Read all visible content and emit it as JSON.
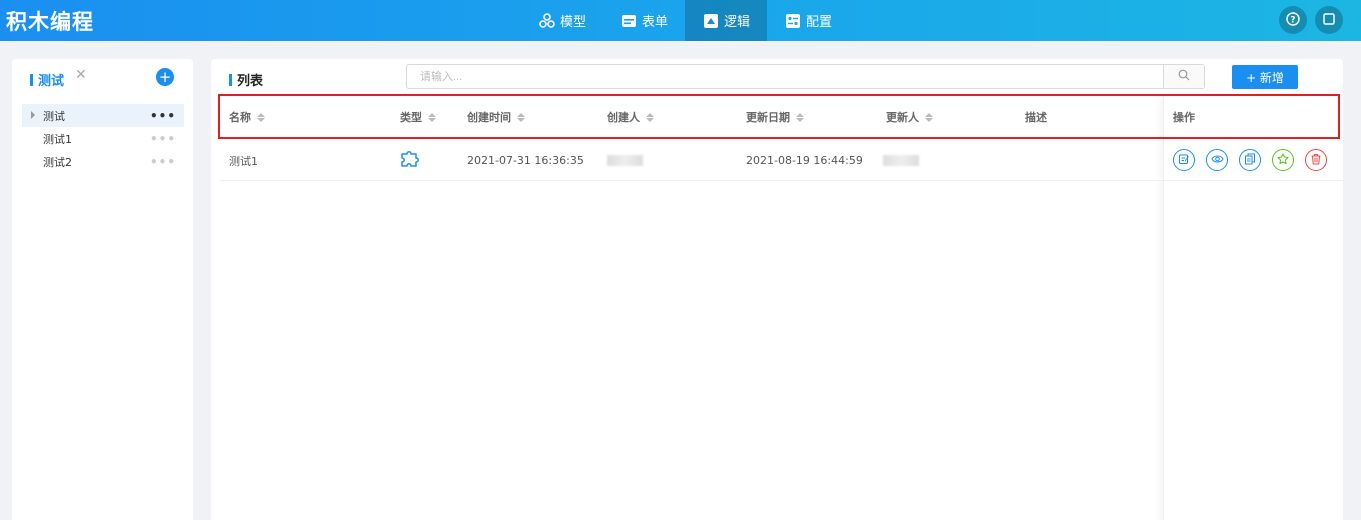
{
  "app": {
    "title": "积木编程"
  },
  "nav": [
    {
      "label": "模型",
      "icon": "model-icon"
    },
    {
      "label": "表单",
      "icon": "form-icon"
    },
    {
      "label": "逻辑",
      "icon": "logic-icon",
      "active": true
    },
    {
      "label": "配置",
      "icon": "config-icon"
    }
  ],
  "header_buttons": {
    "help": "help-icon",
    "window": "window-icon"
  },
  "sidebar": {
    "title": "测试",
    "close": "✕",
    "add": "+",
    "items": [
      {
        "label": "测试",
        "more": "•••",
        "selected": true
      },
      {
        "label": "测试1",
        "more": "•••"
      },
      {
        "label": "测试2",
        "more": "•••"
      }
    ]
  },
  "main": {
    "title": "列表",
    "search": {
      "placeholder": "请输入...",
      "value": ""
    },
    "add_label": "+ 新增",
    "columns": {
      "name": "名称",
      "type": "类型",
      "created_at": "创建时间",
      "creator": "创建人",
      "updated_at": "更新日期",
      "updater": "更新人",
      "desc": "描述",
      "ops": "操作"
    },
    "rows": [
      {
        "name": "测试1",
        "type_icon": "puzzle-icon",
        "created_at": "2021-07-31 16:36:35",
        "updated_at": "2021-08-19 16:44:59",
        "desc": ""
      }
    ],
    "row_actions": [
      "edit-icon",
      "view-icon",
      "copy-icon",
      "publish-icon",
      "delete-icon"
    ]
  },
  "colors": {
    "accent": "#1a8ff0",
    "highlight": "#e02020",
    "success": "#52c41a",
    "danger": "#f5453d"
  }
}
